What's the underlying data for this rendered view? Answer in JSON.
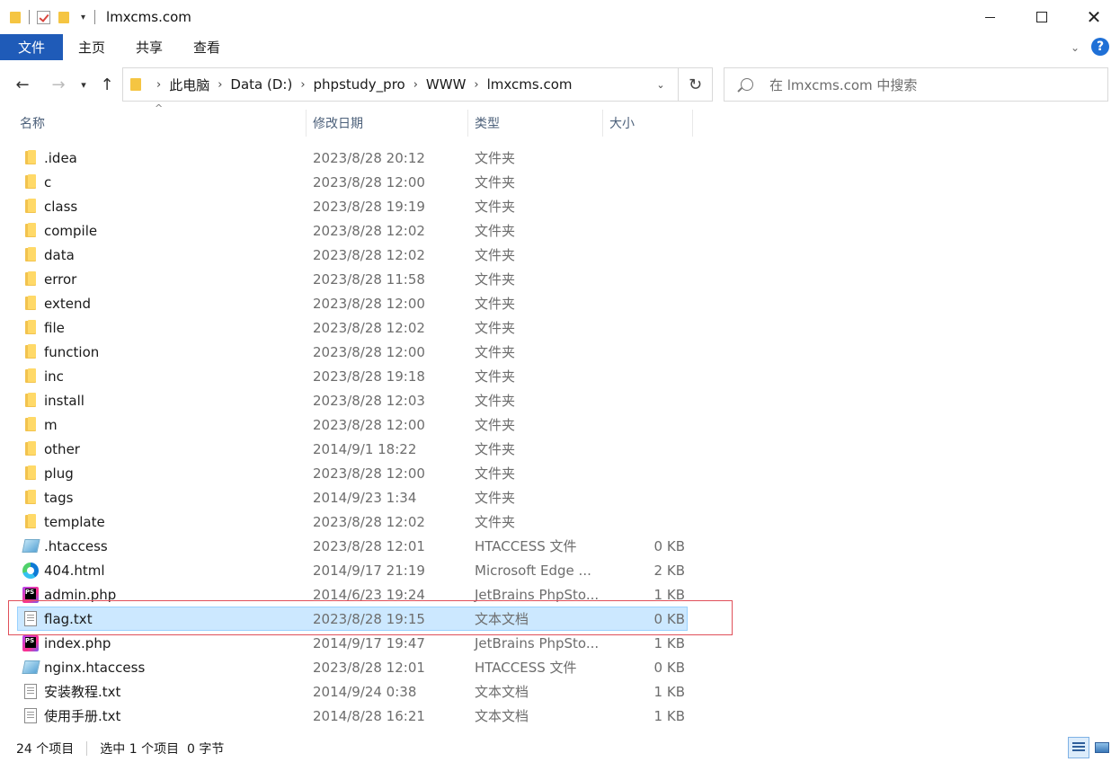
{
  "window": {
    "title": "lmxcms.com",
    "minimize_label": "",
    "close_label": "✕"
  },
  "ribbon": {
    "tabs": [
      "文件",
      "主页",
      "共享",
      "查看"
    ],
    "help_label": "?"
  },
  "address": {
    "crumbs": [
      "此电脑",
      "Data (D:)",
      "phpstudy_pro",
      "WWW",
      "lmxcms.com"
    ]
  },
  "search": {
    "placeholder": "在 lmxcms.com 中搜索"
  },
  "columns": {
    "name": "名称",
    "date": "修改日期",
    "type": "类型",
    "size": "大小"
  },
  "files": [
    {
      "name": ".idea",
      "date": "2023/8/28 20:12",
      "type": "文件夹",
      "size": "",
      "icon": "folder-icon"
    },
    {
      "name": "c",
      "date": "2023/8/28 12:00",
      "type": "文件夹",
      "size": "",
      "icon": "folder-icon"
    },
    {
      "name": "class",
      "date": "2023/8/28 19:19",
      "type": "文件夹",
      "size": "",
      "icon": "folder-icon"
    },
    {
      "name": "compile",
      "date": "2023/8/28 12:02",
      "type": "文件夹",
      "size": "",
      "icon": "folder-icon"
    },
    {
      "name": "data",
      "date": "2023/8/28 12:02",
      "type": "文件夹",
      "size": "",
      "icon": "folder-icon"
    },
    {
      "name": "error",
      "date": "2023/8/28 11:58",
      "type": "文件夹",
      "size": "",
      "icon": "folder-icon"
    },
    {
      "name": "extend",
      "date": "2023/8/28 12:00",
      "type": "文件夹",
      "size": "",
      "icon": "folder-icon"
    },
    {
      "name": "file",
      "date": "2023/8/28 12:02",
      "type": "文件夹",
      "size": "",
      "icon": "folder-icon"
    },
    {
      "name": "function",
      "date": "2023/8/28 12:00",
      "type": "文件夹",
      "size": "",
      "icon": "folder-icon"
    },
    {
      "name": "inc",
      "date": "2023/8/28 19:18",
      "type": "文件夹",
      "size": "",
      "icon": "folder-icon"
    },
    {
      "name": "install",
      "date": "2023/8/28 12:03",
      "type": "文件夹",
      "size": "",
      "icon": "folder-icon"
    },
    {
      "name": "m",
      "date": "2023/8/28 12:00",
      "type": "文件夹",
      "size": "",
      "icon": "folder-icon"
    },
    {
      "name": "other",
      "date": "2014/9/1 18:22",
      "type": "文件夹",
      "size": "",
      "icon": "folder-icon"
    },
    {
      "name": "plug",
      "date": "2023/8/28 12:00",
      "type": "文件夹",
      "size": "",
      "icon": "folder-icon"
    },
    {
      "name": "tags",
      "date": "2014/9/23 1:34",
      "type": "文件夹",
      "size": "",
      "icon": "folder-icon"
    },
    {
      "name": "template",
      "date": "2023/8/28 12:02",
      "type": "文件夹",
      "size": "",
      "icon": "folder-icon"
    },
    {
      "name": ".htaccess",
      "date": "2023/8/28 12:01",
      "type": "HTACCESS 文件",
      "size": "0 KB",
      "icon": "htaccess-file-icon"
    },
    {
      "name": "404.html",
      "date": "2014/9/17 21:19",
      "type": "Microsoft Edge ...",
      "size": "2 KB",
      "icon": "edge-html-icon"
    },
    {
      "name": "admin.php",
      "date": "2014/6/23 19:24",
      "type": "JetBrains PhpSto...",
      "size": "1 KB",
      "icon": "phpstorm-file-icon"
    },
    {
      "name": "flag.txt",
      "date": "2023/8/28 19:15",
      "type": "文本文档",
      "size": "0 KB",
      "icon": "text-file-icon",
      "selected": true
    },
    {
      "name": "index.php",
      "date": "2014/9/17 19:47",
      "type": "JetBrains PhpSto...",
      "size": "1 KB",
      "icon": "phpstorm-file-icon"
    },
    {
      "name": "nginx.htaccess",
      "date": "2023/8/28 12:01",
      "type": "HTACCESS 文件",
      "size": "0 KB",
      "icon": "htaccess-file-icon"
    },
    {
      "name": "安装教程.txt",
      "date": "2014/9/24 0:38",
      "type": "文本文档",
      "size": "1 KB",
      "icon": "text-file-icon"
    },
    {
      "name": "使用手册.txt",
      "date": "2014/8/28 16:21",
      "type": "文本文档",
      "size": "1 KB",
      "icon": "text-file-icon"
    }
  ],
  "status": {
    "item_count": "24 个项目",
    "selection": "选中 1 个项目  0 字节"
  },
  "colors": {
    "accent": "#1f5bb8",
    "selection_bg": "#cce8ff",
    "highlight_outline": "#e0505a"
  }
}
